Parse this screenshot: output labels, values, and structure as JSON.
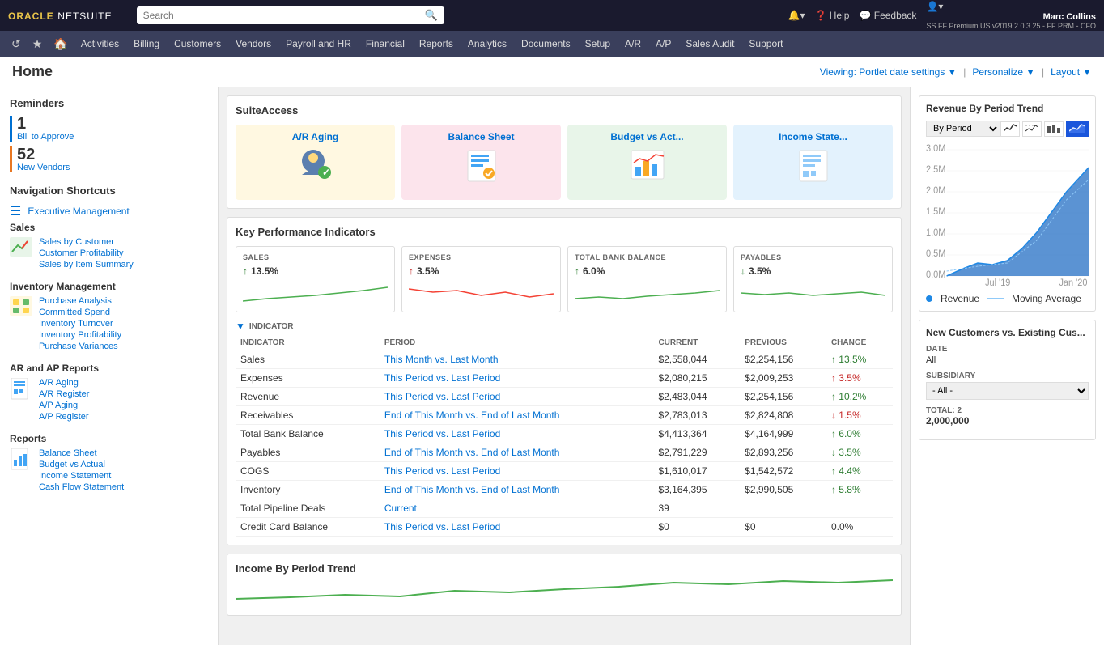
{
  "app": {
    "logo_oracle": "ORACLE",
    "logo_netsuite": "NETSUITE"
  },
  "topbar": {
    "search_placeholder": "Search",
    "bell_label": "🔔",
    "help_label": "Help",
    "feedback_label": "Feedback",
    "user_name": "Marc Collins",
    "user_info": "SS FF Premium US v2019.2.0 3.25 - FF PRM - CFO"
  },
  "navbar": {
    "items": [
      {
        "label": "Activities"
      },
      {
        "label": "Billing"
      },
      {
        "label": "Customers"
      },
      {
        "label": "Vendors"
      },
      {
        "label": "Payroll and HR"
      },
      {
        "label": "Financial"
      },
      {
        "label": "Reports"
      },
      {
        "label": "Analytics"
      },
      {
        "label": "Documents"
      },
      {
        "label": "Setup"
      },
      {
        "label": "A/R"
      },
      {
        "label": "A/P"
      },
      {
        "label": "Sales Audit"
      },
      {
        "label": "Support"
      }
    ]
  },
  "home_header": {
    "title": "Home",
    "viewing_label": "Viewing: Portlet date settings",
    "personalize_label": "Personalize",
    "layout_label": "Layout"
  },
  "sidebar": {
    "reminders_title": "Reminders",
    "reminder1_number": "1",
    "reminder1_label": "Bill to Approve",
    "reminder2_number": "52",
    "reminder2_label": "New Vendors",
    "nav_shortcuts_title": "Navigation Shortcuts",
    "exec_management_label": "Executive Management",
    "sales_title": "Sales",
    "sales_links": [
      "Sales by Customer",
      "Customer Profitability",
      "Sales by Item Summary"
    ],
    "inventory_title": "Inventory Management",
    "inventory_links": [
      "Purchase Analysis",
      "Committed Spend",
      "Inventory Turnover",
      "Inventory Profitability",
      "Purchase Variances"
    ],
    "ar_ap_title": "AR and AP Reports",
    "ar_ap_links": [
      "A/R Aging",
      "A/R Register",
      "A/P Aging",
      "A/P Register"
    ],
    "reports_title": "Reports",
    "reports_links": [
      "Balance Sheet",
      "Budget vs Actual",
      "Income Statement",
      "Cash Flow Statement"
    ]
  },
  "suite_access": {
    "title": "SuiteAccess",
    "cards": [
      {
        "label": "A/R Aging",
        "color": "yellow"
      },
      {
        "label": "Balance Sheet",
        "color": "pink"
      },
      {
        "label": "Budget vs Act...",
        "color": "green"
      },
      {
        "label": "Income State...",
        "color": "blue"
      }
    ]
  },
  "kpi": {
    "title": "Key Performance Indicators",
    "cards": [
      {
        "label": "SALES",
        "value": "13.5%",
        "direction": "up",
        "color": "green"
      },
      {
        "label": "EXPENSES",
        "value": "3.5%",
        "direction": "up",
        "color": "red"
      },
      {
        "label": "TOTAL BANK BALANCE",
        "value": "6.0%",
        "direction": "up",
        "color": "green"
      },
      {
        "label": "PAYABLES",
        "value": "3.5%",
        "direction": "down",
        "color": "green"
      }
    ],
    "table_headers": [
      "INDICATOR",
      "PERIOD",
      "CURRENT",
      "PREVIOUS",
      "CHANGE"
    ],
    "table_rows": [
      {
        "indicator": "Sales",
        "period": "This Month vs. Last Month",
        "current": "$2,558,044",
        "previous": "$2,254,156",
        "change": "↑ 13.5%",
        "change_dir": "up"
      },
      {
        "indicator": "Expenses",
        "period": "This Period vs. Last Period",
        "current": "$2,080,215",
        "previous": "$2,009,253",
        "change": "↑ 3.5%",
        "change_dir": "up-red"
      },
      {
        "indicator": "Revenue",
        "period": "This Period vs. Last Period",
        "current": "$2,483,044",
        "previous": "$2,254,156",
        "change": "↑ 10.2%",
        "change_dir": "up"
      },
      {
        "indicator": "Receivables",
        "period": "End of This Month vs. End of Last Month",
        "current": "$2,783,013",
        "previous": "$2,824,808",
        "change": "↓ 1.5%",
        "change_dir": "down-red"
      },
      {
        "indicator": "Total Bank Balance",
        "period": "This Period vs. Last Period",
        "current": "$4,413,364",
        "previous": "$4,164,999",
        "change": "↑ 6.0%",
        "change_dir": "up"
      },
      {
        "indicator": "Payables",
        "period": "End of This Month vs. End of Last Month",
        "current": "$2,791,229",
        "previous": "$2,893,256",
        "change": "↓ 3.5%",
        "change_dir": "down"
      },
      {
        "indicator": "COGS",
        "period": "This Period vs. Last Period",
        "current": "$1,610,017",
        "previous": "$1,542,572",
        "change": "↑ 4.4%",
        "change_dir": "up"
      },
      {
        "indicator": "Inventory",
        "period": "End of This Month vs. End of Last Month",
        "current": "$3,164,395",
        "previous": "$2,990,505",
        "change": "↑ 5.8%",
        "change_dir": "up"
      },
      {
        "indicator": "Total Pipeline Deals",
        "period": "Current",
        "current": "39",
        "previous": "",
        "change": "",
        "change_dir": ""
      },
      {
        "indicator": "Credit Card Balance",
        "period": "This Period vs. Last Period",
        "current": "$0",
        "previous": "$0",
        "change": "0.0%",
        "change_dir": "neutral"
      }
    ]
  },
  "income_trend": {
    "title": "Income By Period Trend"
  },
  "revenue_chart": {
    "title": "Revenue By Period Trend",
    "dropdown": "By Period",
    "legend_revenue": "Revenue",
    "legend_moving_avg": "Moving Average",
    "y_labels": [
      "3.0M",
      "2.5M",
      "2.0M",
      "1.5M",
      "1.0M",
      "0.5M",
      "0.0M"
    ],
    "x_labels": [
      "Jul '19",
      "Jan '20"
    ]
  },
  "new_customers": {
    "title": "New Customers vs. Existing Cus...",
    "date_label": "DATE",
    "date_value": "All",
    "subsidiary_label": "SUBSIDIARY",
    "subsidiary_value": "- All -",
    "total_label": "TOTAL: 2",
    "total_value": "2,000,000"
  }
}
